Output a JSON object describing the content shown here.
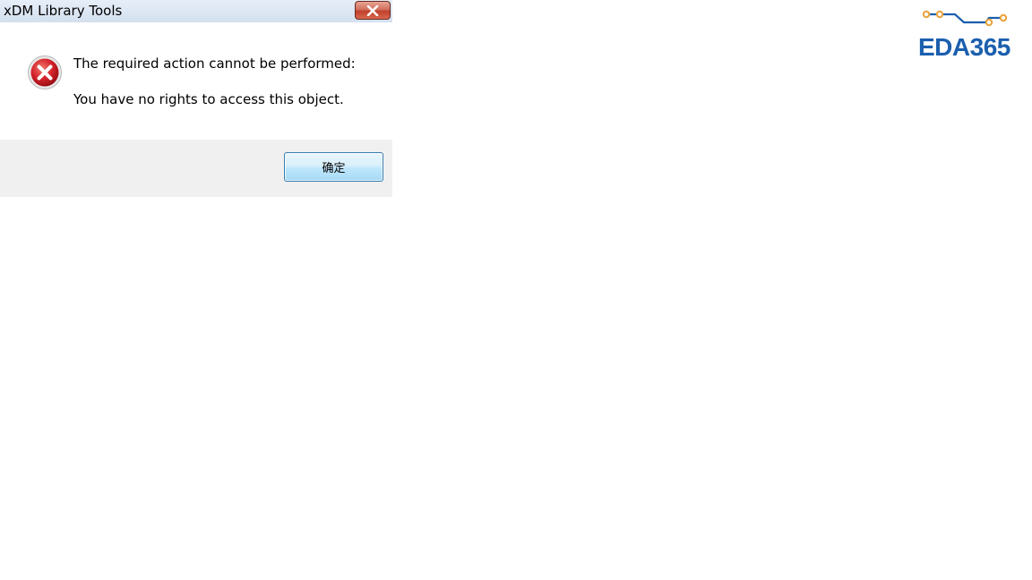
{
  "window": {
    "title": "xDM Library Tools",
    "close_icon": "close-icon"
  },
  "message": {
    "icon": "error-icon",
    "line1": "The required action cannot be performed:",
    "line2": "You have no rights to access this object."
  },
  "buttons": {
    "ok_label": "确定"
  },
  "logo": {
    "text": "EDA365",
    "brand_color": "#1b5fae",
    "accent_color": "#e8a33c"
  }
}
